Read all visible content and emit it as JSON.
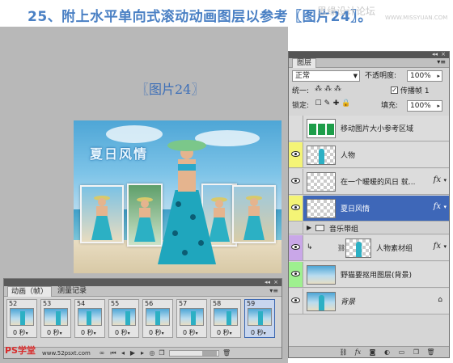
{
  "header": {
    "title": "25、附上水平单向式滚动动画图层以参考〖图片24〗。",
    "watermark": "思缘设计论坛",
    "watermark_url": "WWW.MISSYUAN.COM"
  },
  "canvas": {
    "label": "〖图片24〗",
    "poster_title": "夏日风情"
  },
  "animation_panel": {
    "tabs": [
      {
        "label": "动画（帧）",
        "active": true
      },
      {
        "label": "测量记录",
        "active": false
      }
    ],
    "close_label": "×",
    "menu_label": "▾≡",
    "frames": [
      {
        "number": "52",
        "delay": "0 秒"
      },
      {
        "number": "53",
        "delay": "0 秒"
      },
      {
        "number": "54",
        "delay": "0 秒"
      },
      {
        "number": "55",
        "delay": "0 秒"
      },
      {
        "number": "56",
        "delay": "0 秒"
      },
      {
        "number": "57",
        "delay": "0 秒"
      },
      {
        "number": "58",
        "delay": "0 秒"
      },
      {
        "number": "59",
        "delay": "0 秒"
      }
    ],
    "selected_frame": "59",
    "delay_arrow": "▾",
    "bottom_icons": [
      "loop",
      "first-frame",
      "prev-frame",
      "play",
      "next-frame",
      "tween",
      "duplicate-frame",
      "delete-frame"
    ]
  },
  "site_logo": {
    "text": "PS学堂",
    "url": "www.52psxt.com"
  },
  "layers_panel": {
    "tab": "图层",
    "menu_label": "▾≡",
    "blend_mode": "正常",
    "opacity_label": "不透明度:",
    "opacity_value": "100%",
    "unify_label": "统一:",
    "propagate_label": "传播帧 1",
    "propagate_checked": true,
    "lock_label": "锁定:",
    "fill_label": "填充:",
    "fill_value": "100%",
    "layers": [
      {
        "name": "移动图片大小参考区域",
        "visible": false,
        "thumb": "green-bars",
        "fx": false,
        "selected": false,
        "tag_color": "#d6d6d6"
      },
      {
        "name": "人物",
        "visible": true,
        "thumb": "person",
        "fx": false,
        "selected": false,
        "tag_color": "#f4f476"
      },
      {
        "name": "在一个暖暖的风日 就...",
        "visible": true,
        "thumb": "transparent",
        "fx": true,
        "selected": false,
        "tag_color": "#d6d6d6"
      },
      {
        "name": "夏日风情",
        "visible": true,
        "thumb": "transparent",
        "fx": true,
        "selected": true,
        "tag_color": "#f4f476"
      }
    ],
    "group": {
      "name": "音乐带组",
      "expanded": false
    },
    "clipped_layer": {
      "name": "人物素材组",
      "visible": true,
      "fx": true,
      "tag_color": "#c9a7e8"
    },
    "bottom_layers": [
      {
        "name": "野猫要抠用图层(背景)",
        "visible": true,
        "thumb": "photo",
        "tag_color": "#9ef08f"
      },
      {
        "name": "背景",
        "visible": true,
        "thumb": "photo",
        "tag_color": "#d6d6d6",
        "locked": true
      }
    ],
    "fx_label": "fx",
    "lock_mark": "🔒",
    "bottom_icons": [
      "link-layers",
      "add-style",
      "add-mask",
      "adjustment",
      "new-group",
      "new-layer",
      "delete-layer"
    ]
  }
}
